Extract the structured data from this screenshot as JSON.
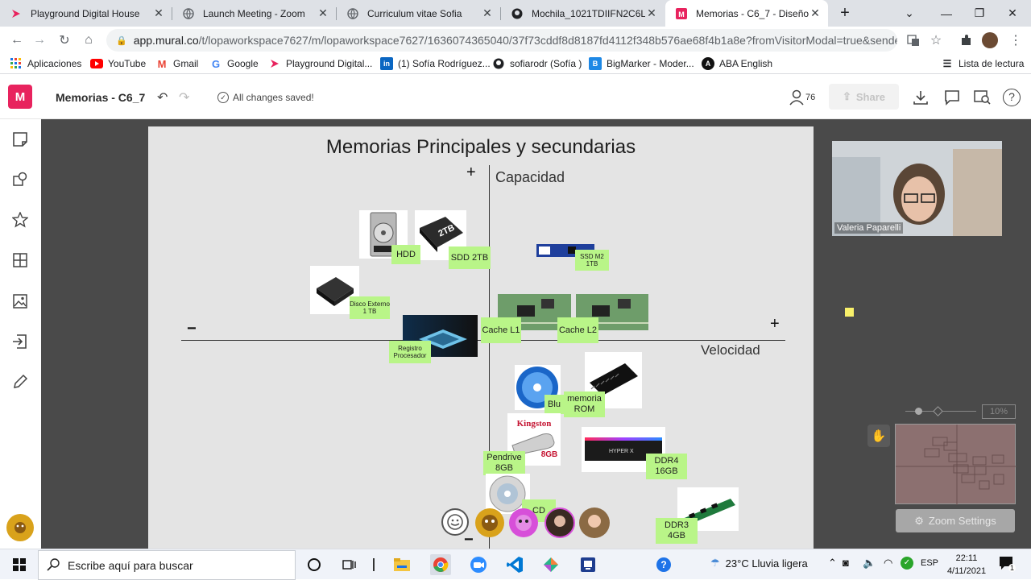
{
  "browser": {
    "tabs": [
      {
        "label": "Playground Digital House",
        "icon": "playground-icon"
      },
      {
        "label": "Launch Meeting - Zoom",
        "icon": "globe-icon"
      },
      {
        "label": "Curriculum vitae Sofia",
        "icon": "globe-icon"
      },
      {
        "label": "Mochila_1021TDIIFN2C6LAE",
        "icon": "github-icon"
      },
      {
        "label": "Memorias - C6_7 - Diseño U",
        "icon": "mural-icon",
        "active": true
      }
    ],
    "url_host": "app.mural.co",
    "url_path": "/t/lopaworkspace7627/m/lopaworkspace7627/1636074365040/37f73cddf8d8187fd4112f348b576ae68f4b1a8e?fromVisitorModal=true&sender=2ee2...",
    "bookmarks": [
      {
        "label": "Aplicaciones",
        "icon": "apps-grid-icon"
      },
      {
        "label": "YouTube",
        "icon": "youtube-icon"
      },
      {
        "label": "Gmail",
        "icon": "gmail-icon"
      },
      {
        "label": "Google",
        "icon": "google-icon"
      },
      {
        "label": "Playground Digital...",
        "icon": "playground-icon"
      },
      {
        "label": "(1) Sofía Rodríguez...",
        "icon": "linkedin-icon"
      },
      {
        "label": "sofiarodr (Sofía )",
        "icon": "github-icon"
      },
      {
        "label": "BigMarker - Moder...",
        "icon": "bigmarker-icon"
      },
      {
        "label": "ABA English",
        "icon": "aba-icon"
      }
    ],
    "reading_list": "Lista de lectura"
  },
  "mural": {
    "logo": "M",
    "title": "Memorias - C6_7",
    "save_status": "All changes saved!",
    "participants": "76",
    "share_label": "Share"
  },
  "board": {
    "title": "Memorias Principales y secundarias",
    "y_axis_label": "Capacidad",
    "x_axis_label": "Velocidad",
    "plus_top": "+",
    "plus_right": "+",
    "minus_left": "−",
    "minus_bottom": "−",
    "stickies": {
      "hdd": "HDD",
      "ssd2tb": "SDD 2TB",
      "ssdm2": "SSD M2 1TB",
      "disco": "Disco Externo 1 TB",
      "registro": "Registro Procesador",
      "cache_l1": "Cache L1",
      "cache_l2": "Cache L2",
      "blu": "Blu",
      "rom": "memoria ROM",
      "pendrive": "Pendrive 8GB",
      "ddr4": "DDR4 16GB",
      "ddr3": "DDR3 4GB",
      "cd": "CD"
    },
    "ssd_label": "2TB",
    "kingston": "Kingston",
    "kingston_size": "8GB",
    "hyperx": "HYPER X"
  },
  "video": {
    "name": "Valeria Paparelli"
  },
  "zoom": {
    "percent": "10%",
    "settings_label": "Zoom Settings"
  },
  "taskbar": {
    "search_placeholder": "Escribe aquí para buscar",
    "weather": "23°C  Lluvia ligera",
    "lang": "ESP",
    "time": "22:11",
    "date": "4/11/2021",
    "notifications": "1"
  }
}
